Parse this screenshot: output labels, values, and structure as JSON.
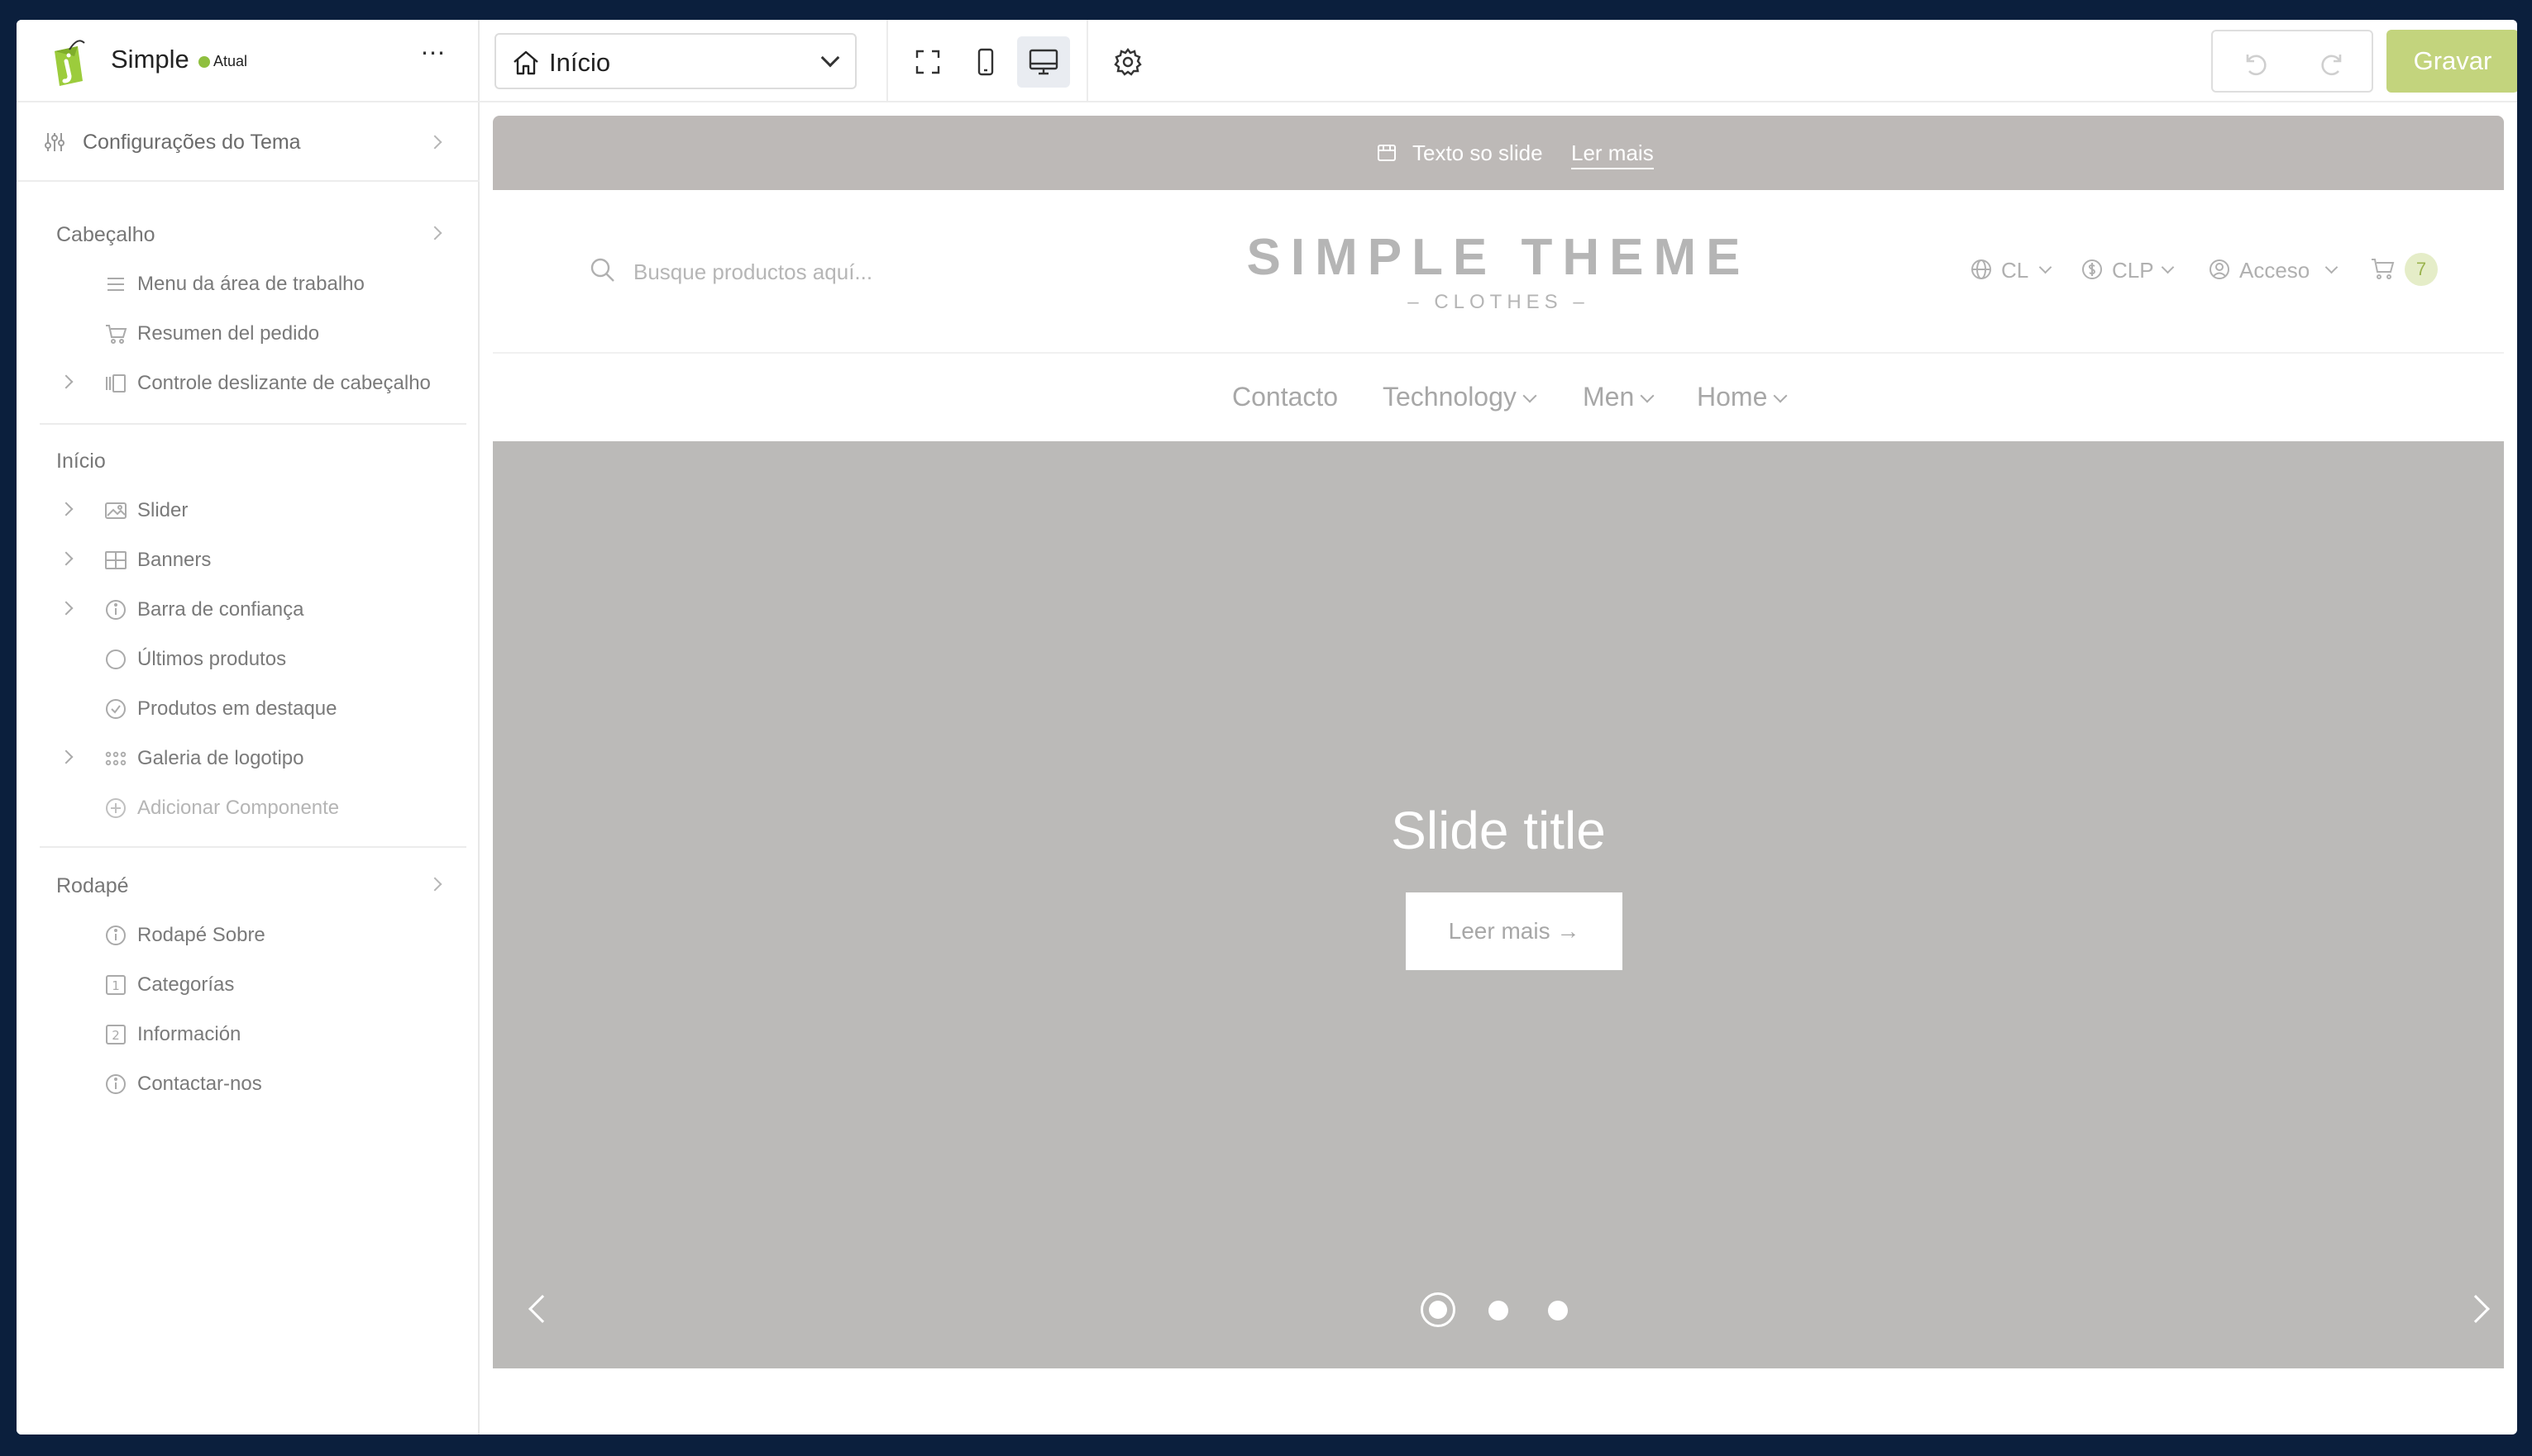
{
  "sidebar": {
    "theme_name": "Simple",
    "status": "Atual",
    "more_icon": "⋯",
    "theme_settings_label": "Configurações do Tema",
    "header_section": {
      "title": "Cabeçalho",
      "items": [
        {
          "label": "Menu da área de trabalho",
          "icon": "menu-lines-icon"
        },
        {
          "label": "Resumen del pedido",
          "icon": "cart-icon"
        },
        {
          "label": "Controle deslizante de cabeçalho",
          "icon": "slides-icon"
        }
      ]
    },
    "home_section": {
      "title": "Início",
      "items": [
        {
          "label": "Slider",
          "icon": "image-icon"
        },
        {
          "label": "Banners",
          "icon": "grid-icon"
        },
        {
          "label": "Barra de confiança",
          "icon": "info-icon"
        },
        {
          "label": "Últimos produtos",
          "icon": "circle-icon"
        },
        {
          "label": "Produtos em destaque",
          "icon": "check-circle-icon"
        },
        {
          "label": "Galeria de logotipo",
          "icon": "dots-grid-icon"
        },
        {
          "label": "Adicionar Componente",
          "icon": "plus-circle-icon"
        }
      ]
    },
    "footer_section": {
      "title": "Rodapé",
      "items": [
        {
          "label": "Rodapé Sobre",
          "icon": "info-icon"
        },
        {
          "label": "Categorías",
          "icon": "square-1-icon",
          "badge": "1"
        },
        {
          "label": "Información",
          "icon": "square-2-icon",
          "badge": "2"
        },
        {
          "label": "Contactar-nos",
          "icon": "info-icon"
        }
      ]
    }
  },
  "toolbar": {
    "page_select_value": "Início",
    "save_label": "Gravar"
  },
  "preview": {
    "announcement": {
      "text": "Texto so slide",
      "link": "Ler mais"
    },
    "header": {
      "search_placeholder": "Busque productos aquí...",
      "brand_title": "SIMPLE THEME",
      "brand_subtitle": "– CLOTHES –",
      "country": "CL",
      "currency": "CLP",
      "account": "Acceso",
      "cart_count": "7"
    },
    "nav": [
      "Contacto",
      "Technology",
      "Men",
      "Home"
    ],
    "slider": {
      "title": "Slide title",
      "button": "Leer mais →",
      "slide_count": 3,
      "active_slide": 1
    }
  },
  "colors": {
    "accent": "#c3d47d",
    "status_green": "#8fbf3f",
    "announcement_bg": "#bdb9b7",
    "slider_bg": "#bbbab8",
    "frame_bg": "#0b1f3d"
  }
}
